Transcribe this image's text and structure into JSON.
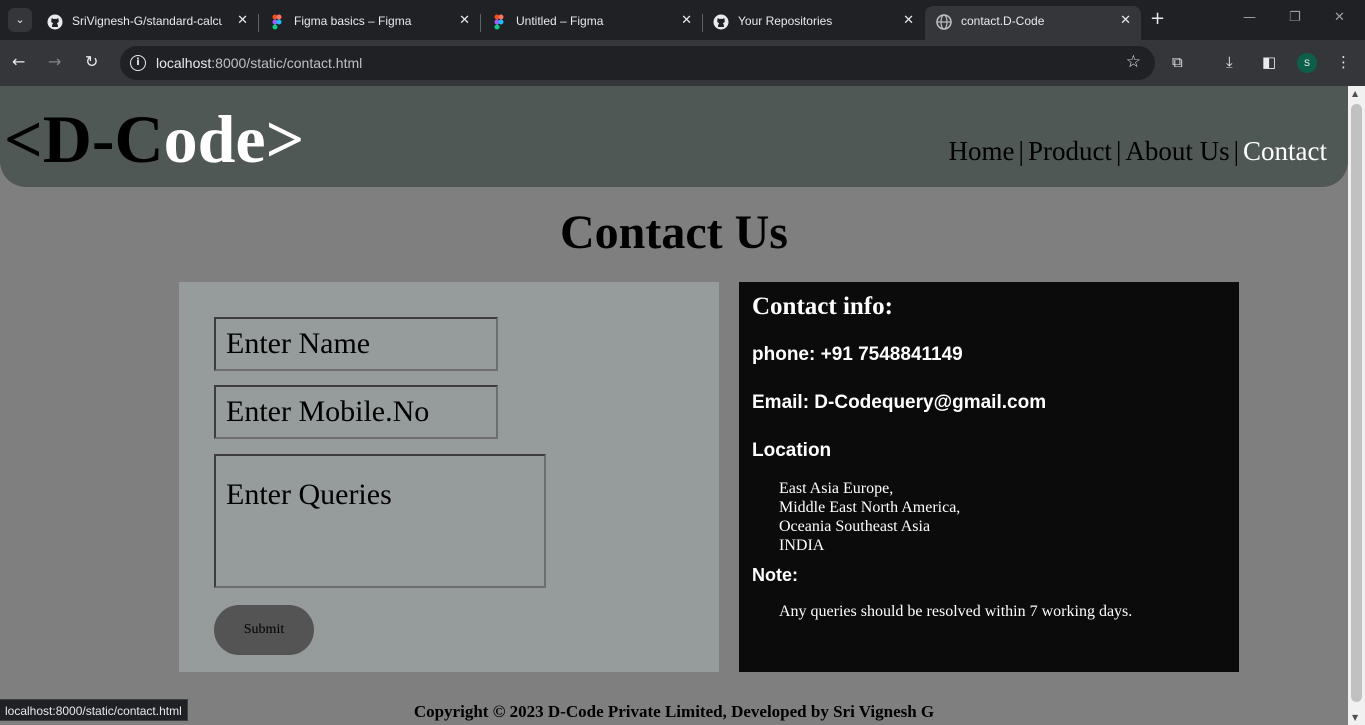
{
  "browser": {
    "tabs": [
      {
        "title": "SriVignesh-G/standard-calcu",
        "icon": "github-icon"
      },
      {
        "title": "Figma basics – Figma",
        "icon": "figma-icon"
      },
      {
        "title": "Untitled – Figma",
        "icon": "figma-icon"
      },
      {
        "title": "Your Repositories",
        "icon": "github-icon"
      },
      {
        "title": "contact.D-Code",
        "icon": "globe-icon",
        "active": true
      }
    ],
    "url_host": "localhost",
    "url_rest": ":8000/static/contact.html",
    "profile_initial": "S",
    "status_url": "localhost:8000/static/contact.html"
  },
  "site": {
    "logo_lt": "<",
    "logo_dark": "D-C",
    "logo_light": "ode>",
    "nav": [
      "Home",
      "Product",
      "About Us",
      "Contact"
    ],
    "nav_sep": "|"
  },
  "page": {
    "title": "Contact Us",
    "form": {
      "name_placeholder": "Enter Name",
      "mobile_placeholder": "Enter Mobile.No",
      "queries_placeholder": "Enter Queries",
      "submit_label": "Submit"
    },
    "info": {
      "heading": "Contact info:",
      "phone": "phone: +91 7548841149",
      "email": "Email: D-Codequery@gmail.com",
      "location_label": "Location",
      "locations": [
        "East Asia Europe,",
        "Middle East North America,",
        "Oceania Southeast Asia",
        "INDIA"
      ],
      "note_label": "Note:",
      "note_text": "Any queries should be resolved within 7 working days."
    },
    "footer": "Copyright © 2023 D-Code Private Limited, Developed by Sri Vignesh G"
  },
  "colors": {
    "page_bg": "#7f7f7f",
    "header_bg": "#4f5855",
    "form_bg": "#969b9b",
    "info_bg": "#0b0b0b",
    "submit_bg": "#545454"
  }
}
